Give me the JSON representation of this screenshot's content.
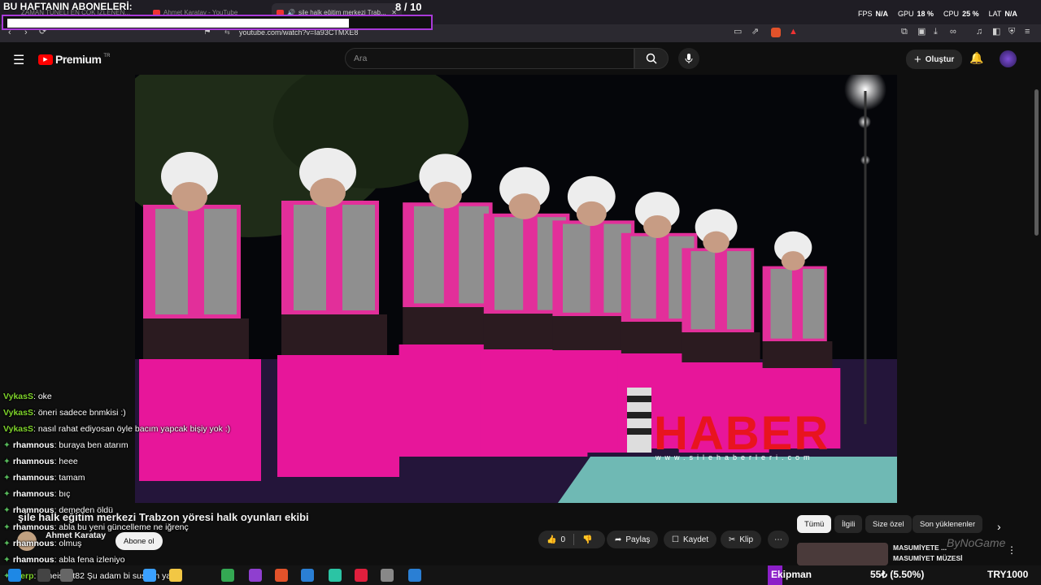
{
  "tabs": [
    {
      "label": "ZAMAN TÜNELİ EN ÇOK İZLENEN..."
    },
    {
      "label": "Ahmet Karatay - YouTube"
    },
    {
      "label": "şile halk eğitim merkezi Trab..."
    }
  ],
  "overlay": {
    "title": "BU HAFTANIN ABONELERİ:",
    "count": "8 / 10"
  },
  "stats": {
    "fps_label": "FPS",
    "fps": "N/A",
    "gpu_label": "GPU",
    "gpu": "18 %",
    "cpu_label": "CPU",
    "cpu": "25 %",
    "lat_label": "LAT",
    "lat": "N/A"
  },
  "address": {
    "url": "youtube.com/watch?v=Ia93CTMXE8"
  },
  "youtube": {
    "logo": "Premium",
    "region": "TR",
    "search_placeholder": "Ara",
    "create_label": "Oluştur"
  },
  "video": {
    "watermark": "HABER",
    "watermark_sub": "www.silehaberleri.com"
  },
  "chat": [
    {
      "user": "VykasS",
      "msg": ": oke",
      "green": true,
      "star": false
    },
    {
      "user": "VykasS",
      "msg": ": öneri sadece bnmkisi :)",
      "green": true,
      "star": false
    },
    {
      "user": "VykasS",
      "msg": ": nasıl rahat ediyosan öyle bacım yapcak bişiy yok :)",
      "green": true,
      "star": false
    },
    {
      "user": "rhamnous",
      "msg": ": buraya ben atarım",
      "green": false,
      "star": true
    },
    {
      "user": "rhamnous",
      "msg": ": heee",
      "green": false,
      "star": true
    },
    {
      "user": "rhamnous",
      "msg": ": tamam",
      "green": false,
      "star": true
    },
    {
      "user": "rhamnous",
      "msg": ": bıç",
      "green": false,
      "star": true
    },
    {
      "user": "rhamnous",
      "msg": ": demeden öldü",
      "green": false,
      "star": true
    },
    {
      "user": "rhamnous",
      "msg": ": abla bu yeni güncelleme ne iğrenç",
      "green": false,
      "star": true
    },
    {
      "user": "rhamnous",
      "msg": ": olmuş",
      "green": false,
      "star": true
    },
    {
      "user": "rhamnous",
      "msg": ": abla fena izleniyo",
      "green": false,
      "star": true
    },
    {
      "user": "blerp",
      "msg": ": Timeisout82 Şu adam bi sussun ya",
      "green": true,
      "star": true
    }
  ],
  "video_info": {
    "title": "şile halk eğitim merkezi Trabzon yöresi halk oyunları ekibi",
    "channel": "Ahmet Karatay",
    "subscribe": "Abone ol",
    "likes": "0",
    "share": "Paylaş",
    "save": "Kaydet",
    "clip": "Klip"
  },
  "chips": [
    "Tümü",
    "İlgili",
    "Size özel",
    "Son yüklenenler"
  ],
  "recommendation": {
    "title": "MASUMİYETE ...",
    "subtitle": "MASUMİYET MÜZESİ"
  },
  "taskbar": {
    "stream_label": "Ekipman",
    "donation": "55₺ (5.50%)",
    "goal": "TRY1000"
  },
  "brand": "ByNoGame"
}
